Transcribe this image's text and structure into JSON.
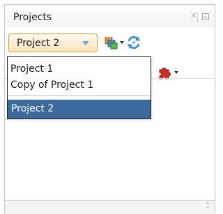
{
  "window": {
    "title": "Projects"
  },
  "toolbar": {
    "project_selector": {
      "selected": "Project 2"
    }
  },
  "dropdown": {
    "options": [
      "Project 1",
      "Copy of Project 1",
      "Project 2"
    ],
    "selected_index": 2
  },
  "icons": {
    "close": "close-icon",
    "minimize": "minimize-icon",
    "new_project": "new-project-icon",
    "synchronize": "synchronize-icon",
    "puzzle": "puzzle-icon",
    "scroll_up": "scroll-up-icon"
  },
  "colors": {
    "selection": "#3d6a9c",
    "combo_border": "#d99a3b"
  }
}
